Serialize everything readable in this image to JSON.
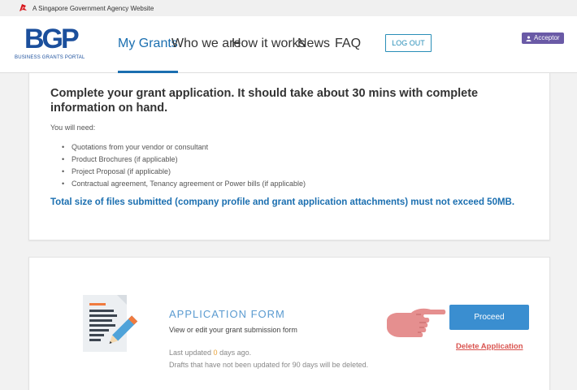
{
  "gov_banner": {
    "text": "A Singapore Government Agency Website",
    "icon": "singapore-lion-icon"
  },
  "header": {
    "logo": {
      "mark": "BGP",
      "subtitle": "BUSINESS GRANTS PORTAL"
    },
    "nav": [
      {
        "label": "My Grants",
        "active": true
      },
      {
        "label": "Who we are",
        "active": false
      },
      {
        "label": "How it works",
        "active": false
      },
      {
        "label": "News",
        "active": false
      },
      {
        "label": "FAQ",
        "active": false
      }
    ],
    "logout_label": "LOG OUT",
    "role_badge": {
      "label": "Acceptor",
      "icon": "user-icon"
    }
  },
  "intro": {
    "headline": "Complete your grant application. It should take about 30 mins with complete information on hand.",
    "need_label": "You will need:",
    "items": [
      "Quotations from your vendor or consultant",
      "Product Brochures (if applicable)",
      "Project Proposal (if applicable)",
      "Contractual agreement, Tenancy agreement or Power bills (if applicable)"
    ],
    "file_limit": "Total size of files submitted (company profile and grant application attachments) must not exceed 50MB."
  },
  "application": {
    "title": "APPLICATION FORM",
    "subtitle": "View or edit your grant submission form",
    "last_updated_prefix": "Last updated ",
    "last_updated_days": "0",
    "last_updated_suffix": " days ago.",
    "drafts_note": "Drafts that have not been updated for 90 days will be deleted.",
    "proceed_label": "Proceed",
    "delete_label": "Delete Application"
  },
  "colors": {
    "brand_blue": "#1b4f9c",
    "link_blue": "#1b6fb0",
    "proceed_button": "#3a8ed0",
    "delete_red": "#d9534f",
    "badge_purple": "#6a5aa6",
    "days_highlight": "#e8a23a"
  }
}
